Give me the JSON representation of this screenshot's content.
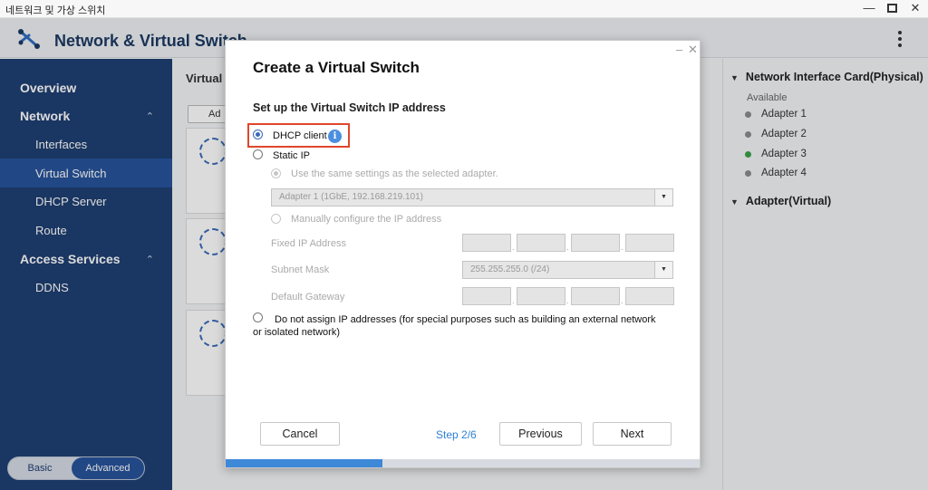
{
  "os": {
    "title": "네트워크 및 가상 스위치"
  },
  "app": {
    "title": "Network & Virtual Switch"
  },
  "sidebar": {
    "overview": "Overview",
    "network": "Network",
    "interfaces": "Interfaces",
    "virtual_switch": "Virtual Switch",
    "dhcp_server": "DHCP Server",
    "route": "Route",
    "access_services": "Access Services",
    "ddns": "DDNS",
    "mode_basic": "Basic",
    "mode_advanced": "Advanced"
  },
  "main": {
    "title": "Virtual",
    "add_button": "Ad"
  },
  "right_panel": {
    "nic_header": "Network Interface Card(Physical)",
    "available": "Available",
    "adapters": [
      {
        "label": "Adapter 1",
        "status": "gray"
      },
      {
        "label": "Adapter 2",
        "status": "gray"
      },
      {
        "label": "Adapter 3",
        "status": "green"
      },
      {
        "label": "Adapter 4",
        "status": "gray"
      }
    ],
    "virtual_header": "Adapter(Virtual)"
  },
  "dialog": {
    "title": "Create a Virtual Switch",
    "subtitle": "Set up the Virtual Switch IP address",
    "dhcp_client": "DHCP client",
    "static_ip": "Static IP",
    "same_settings": "Use the same settings as the selected adapter.",
    "adapter_select": "Adapter 1 (1GbE, 192.168.219.101)",
    "manual_config": "Manually configure the IP address",
    "fixed_ip_label": "Fixed IP Address",
    "subnet_label": "Subnet Mask",
    "subnet_value": "255.255.255.0 (/24)",
    "gateway_label": "Default Gateway",
    "no_ip": "Do not assign IP addresses (for special purposes such as building an external network or isolated network)",
    "cancel": "Cancel",
    "step": "Step 2/6",
    "previous": "Previous",
    "next": "Next",
    "progress": 0.33
  },
  "colors": {
    "sidebar_bg": "#1f3f73",
    "sidebar_active": "#27539b",
    "accent_blue": "#3e88d8",
    "highlight_red": "#e0462c",
    "status_green": "#3aa24a",
    "status_gray": "#8c8c8c"
  }
}
